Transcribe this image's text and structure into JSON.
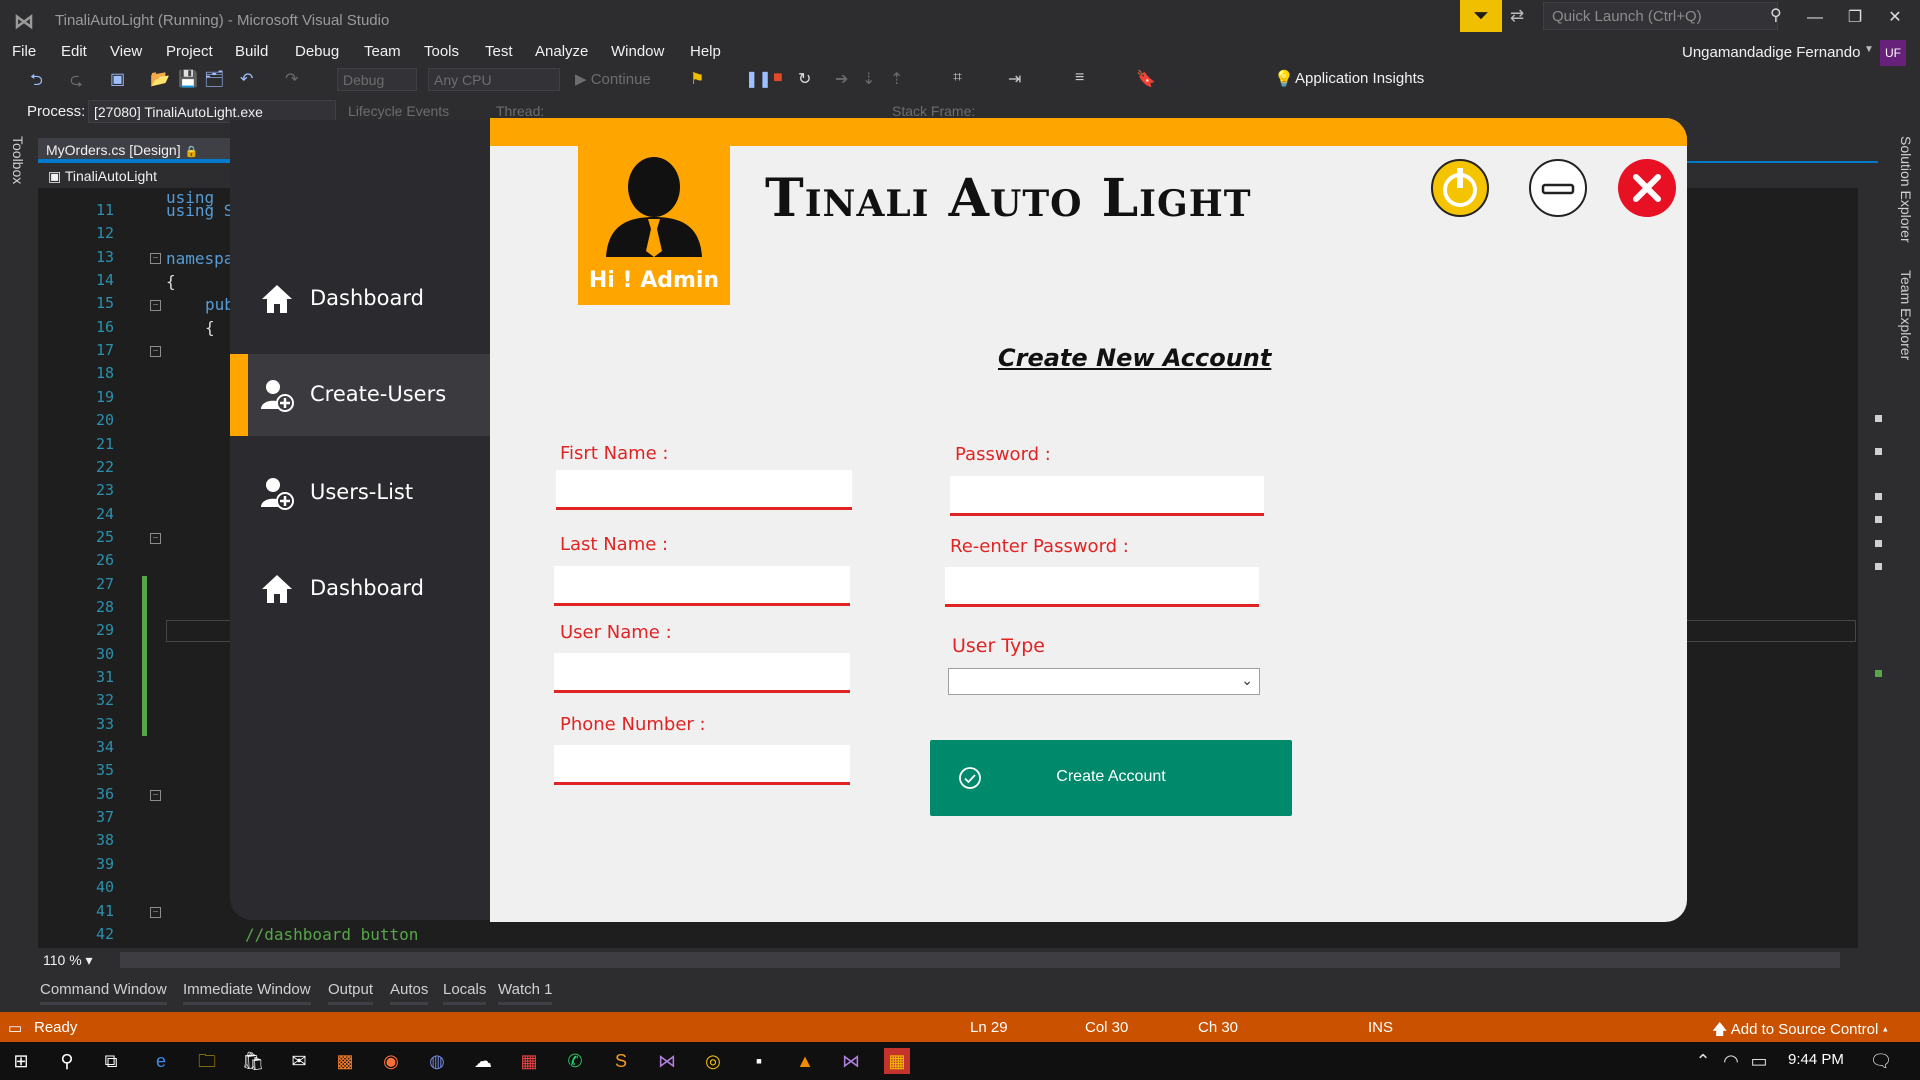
{
  "window": {
    "title": "TinaliAutoLight (Running) - Microsoft Visual Studio",
    "quick_launch_placeholder": "Quick Launch (Ctrl+Q)",
    "user_name": "Ungamandadige Fernando",
    "user_initials": "UF"
  },
  "menu": [
    "File",
    "Edit",
    "View",
    "Project",
    "Build",
    "Debug",
    "Team",
    "Tools",
    "Test",
    "Analyze",
    "Window",
    "Help"
  ],
  "toolbar": {
    "config": "Debug",
    "platform": "Any CPU",
    "continue_label": "Continue",
    "app_insights": "Application Insights"
  },
  "debug_location": {
    "process_label": "Process:",
    "process_value": "[27080] TinaliAutoLight.exe",
    "lifecycle": "Lifecycle Events",
    "thread_label": "Thread:",
    "stack_label": "Stack Frame:"
  },
  "side_panels": {
    "toolbox": "Toolbox",
    "solution_explorer": "Solution Explorer",
    "team_explorer": "Team Explorer"
  },
  "editor": {
    "doc_tab": "MyOrders.cs [Design]",
    "nav_class": "TinaliAutoLight",
    "zoom": "110 %",
    "line_numbers": [
      "11",
      "12",
      "13",
      "14",
      "15",
      "16",
      "17",
      "18",
      "19",
      "20",
      "21",
      "22",
      "23",
      "24",
      "25",
      "26",
      "27",
      "28",
      "29",
      "30",
      "31",
      "32",
      "33",
      "34",
      "35",
      "36",
      "37",
      "38",
      "39",
      "40",
      "41",
      "42"
    ],
    "code_using1": "using ",
    "code_using2": "using S",
    "code_namespace": "namespa",
    "code_brace": "{",
    "code_pub": "pub",
    "code_brace2": "{",
    "code_comment": "//dashboard button"
  },
  "bottom_tabs": [
    "Command Window",
    "Immediate Window",
    "Output",
    "Autos",
    "Locals",
    "Watch 1"
  ],
  "status": {
    "ready": "Ready",
    "ln": "Ln 29",
    "col": "Col 30",
    "ch": "Ch 30",
    "ins": "INS",
    "source_control": "Add to Source Control"
  },
  "taskbar": {
    "time": "9:44 PM"
  },
  "app": {
    "title": "Tinali Auto Light",
    "greeting": "Hi ! Admin",
    "sidebar": [
      {
        "label": "Dashboard",
        "icon": "home-icon"
      },
      {
        "label": "Create-Users",
        "icon": "add-user-icon",
        "active": true
      },
      {
        "label": "Users-List",
        "icon": "add-user-icon"
      },
      {
        "label": "Dashboard",
        "icon": "home-icon"
      }
    ],
    "form": {
      "heading": "Create New Account",
      "first_name_label": "Fisrt Name :",
      "last_name_label": "Last Name :",
      "user_name_label": "User Name :",
      "phone_label": "Phone Number :",
      "password_label": "Password :",
      "reenter_label": "Re-enter Password :",
      "user_type_label": "User Type",
      "user_type_value": "",
      "submit_label": "Create Account"
    },
    "colors": {
      "accent": "#ffa500",
      "error_red": "#e02424",
      "submit_green": "#00896b",
      "sidebar": "#2b2b2f"
    }
  }
}
